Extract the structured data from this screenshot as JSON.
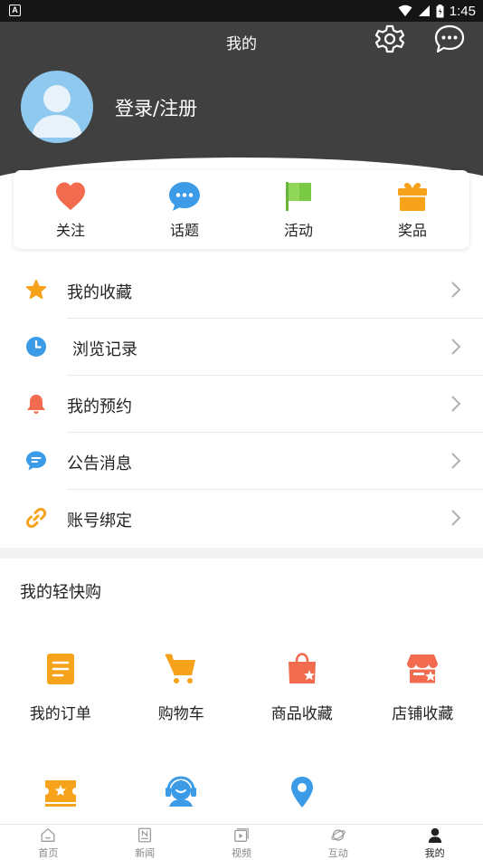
{
  "status_bar": {
    "time": "1:45",
    "left_icon": "A"
  },
  "header": {
    "title": "我的",
    "login_text": "登录/注册"
  },
  "quick_actions": [
    {
      "label": "关注",
      "icon": "heart-icon",
      "color": "#f26b4f"
    },
    {
      "label": "话题",
      "icon": "chat-bubble-icon",
      "color": "#3b9be6"
    },
    {
      "label": "活动",
      "icon": "flag-icon",
      "color": "#7ac943"
    },
    {
      "label": "奖品",
      "icon": "gift-icon",
      "color": "#f7a21b"
    }
  ],
  "menu": [
    {
      "label": "我的收藏",
      "icon": "star-icon",
      "color": "#f7a21b"
    },
    {
      "label": "浏览记录",
      "icon": "clock-icon",
      "color": "#3b9be6"
    },
    {
      "label": "我的预约",
      "icon": "bell-icon",
      "color": "#f26b4f"
    },
    {
      "label": "公告消息",
      "icon": "message-icon",
      "color": "#3b9be6"
    },
    {
      "label": "账号绑定",
      "icon": "link-icon",
      "color": "#f7a21b"
    }
  ],
  "shop": {
    "title": "我的轻快购",
    "items": [
      {
        "label": "我的订单",
        "icon": "order-icon",
        "color": "#f7a21b"
      },
      {
        "label": "购物车",
        "icon": "cart-icon",
        "color": "#f7a21b"
      },
      {
        "label": "商品收藏",
        "icon": "product-favorite-icon",
        "color": "#f26b4f"
      },
      {
        "label": "店铺收藏",
        "icon": "store-favorite-icon",
        "color": "#f26b4f"
      },
      {
        "label": "",
        "icon": "coupon-icon",
        "color": "#f7a21b"
      },
      {
        "label": "",
        "icon": "customer-service-icon",
        "color": "#3b9be6"
      },
      {
        "label": "",
        "icon": "location-pin-icon",
        "color": "#3b9be6"
      }
    ]
  },
  "bottom_nav": [
    {
      "label": "首页",
      "icon": "home-icon",
      "active": false
    },
    {
      "label": "新闻",
      "icon": "news-icon",
      "active": false
    },
    {
      "label": "视频",
      "icon": "video-icon",
      "active": false
    },
    {
      "label": "互动",
      "icon": "planet-icon",
      "active": false
    },
    {
      "label": "我的",
      "icon": "user-icon",
      "active": true
    }
  ]
}
